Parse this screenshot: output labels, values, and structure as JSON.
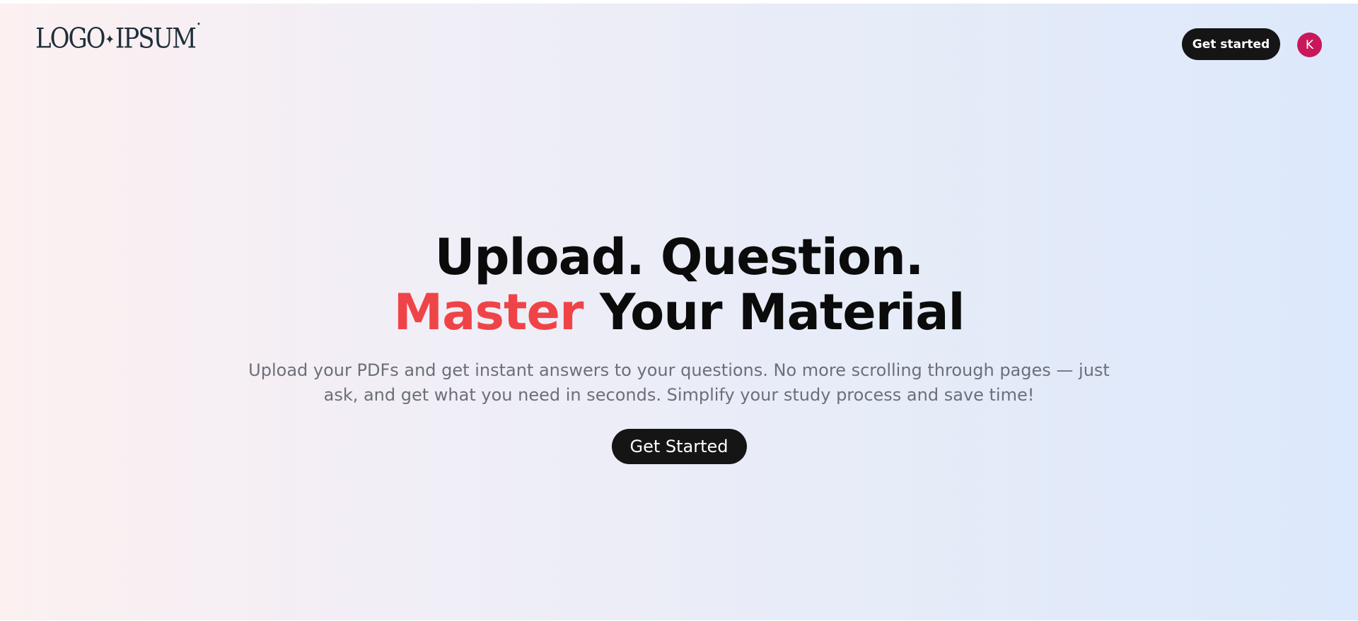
{
  "header": {
    "logo": {
      "part1": "LOGO",
      "star": "✦",
      "part2": "IPSUM",
      "dot": "•"
    },
    "get_started_label": "Get started",
    "avatar": {
      "initial": "K",
      "color": "#c8185a"
    }
  },
  "hero": {
    "headline_line1": "Upload. Question.",
    "headline_accent": "Master",
    "headline_line2_rest": " Your Material",
    "accent_color": "#ef4447",
    "subtitle": "Upload your PDFs and get instant answers to your questions. No more scrolling through pages — just ask, and get what you need in seconds. Simplify your study process and save time!",
    "cta_label": "Get Started"
  }
}
